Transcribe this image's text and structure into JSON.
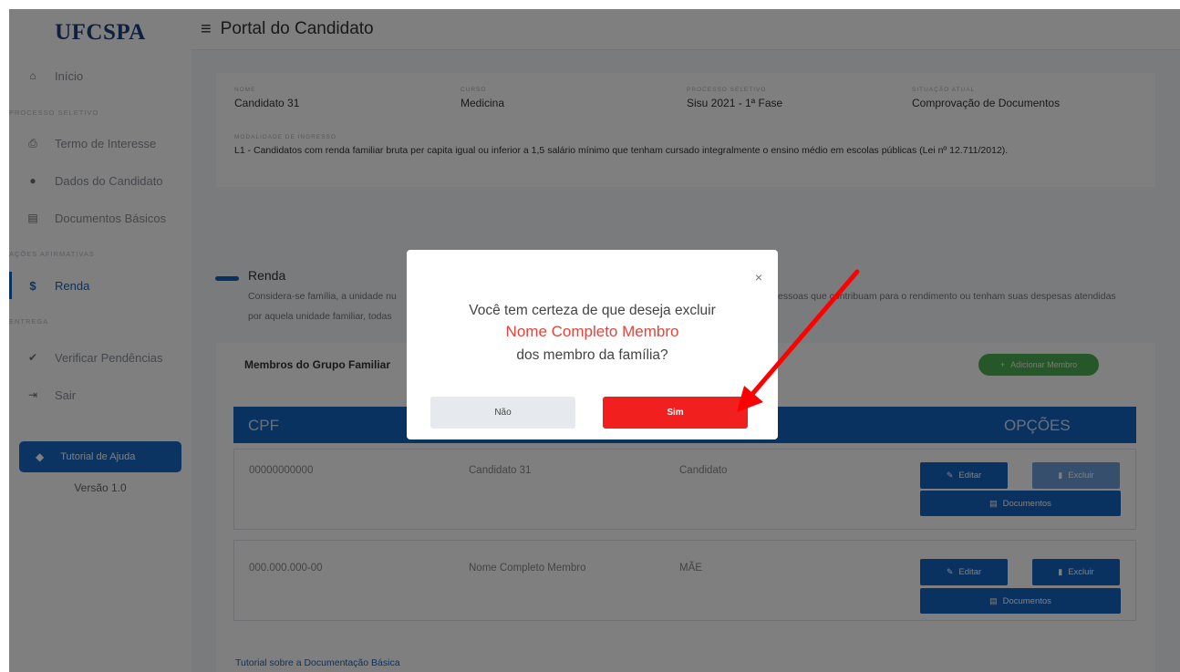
{
  "sidebar": {
    "logo": "UFCSPA",
    "items": [
      {
        "label": "Início",
        "icon": "home-icon",
        "glyph": "⌂"
      },
      {
        "label": "Termo de Interesse",
        "icon": "print-icon",
        "glyph": "⎙"
      },
      {
        "label": "Dados do Candidato",
        "icon": "user-icon",
        "glyph": "●"
      },
      {
        "label": "Documentos Básicos",
        "icon": "file-icon",
        "glyph": "▤"
      },
      {
        "label": "Renda",
        "icon": "dollar-icon",
        "glyph": "$"
      },
      {
        "label": "Verificar Pendências",
        "icon": "check-icon",
        "glyph": "✔"
      },
      {
        "label": "Sair",
        "icon": "sign-out-icon",
        "glyph": "⇥"
      }
    ],
    "sections": [
      "Processo Seletivo",
      "Ações Afirmativas",
      "Entrega"
    ],
    "help_button": "Tutorial de Ajuda",
    "help_icon_glyph": "◆",
    "version": "Versão 1.0"
  },
  "header": {
    "menu_glyph": "≡",
    "title": "Portal do Candidato"
  },
  "info": {
    "nome_label": "Nome",
    "nome": "Candidato 31",
    "curso_label": "Curso",
    "curso": "Medicina",
    "processo_label": "Processo Seletivo",
    "processo": "Sisu 2021 - 1ª Fase",
    "situacao_label": "Situação Atual",
    "situacao": "Comprovação de Documentos",
    "modalidade_label": "Modalidade de Ingresso",
    "modalidade": "L1 - Candidatos com renda familiar bruta per capita igual ou inferior a 1,5 salário mínimo que tenham cursado integralmente o ensino médio em escolas públicas (Lei nº 12.711/2012)."
  },
  "renda": {
    "title": "Renda",
    "desc_line1_left": "Considera-se família, a unidade nu",
    "desc_line1_right": "essoas que contribuam para o rendimento ou tenham suas despesas atendidas",
    "desc_line2_left": "por aquela unidade familiar, todas"
  },
  "members": {
    "title": "Membros do Grupo Familiar",
    "add_button": "Adicionar Membro",
    "add_glyph": "+",
    "headers": {
      "cpf": "CPF",
      "options": "OPÇÕES"
    },
    "rows": [
      {
        "cpf": "00000000000",
        "nome": "Candidato 31",
        "parentesco": "Candidato"
      },
      {
        "cpf": "000.000.000-00",
        "nome": "Nome Completo Membro",
        "parentesco": "MÃE"
      }
    ],
    "edit_label": "Editar",
    "delete_label": "Excluir",
    "docs_label": "Documentos",
    "edit_glyph": "✎",
    "delete_glyph": "▮",
    "docs_glyph": "▤"
  },
  "tutorial_link": "Tutorial sobre a Documentação Básica",
  "modal": {
    "close": "×",
    "line1": "Você tem certeza de que deseja excluir",
    "name": "Nome Completo Membro",
    "line3": "dos membro da família?",
    "no": "Não",
    "yes": "Sim"
  },
  "colors": {
    "primary": "#1565c0",
    "danger": "#f21f1f",
    "success": "#4caf50",
    "annotation_arrow": "#ff0000"
  }
}
